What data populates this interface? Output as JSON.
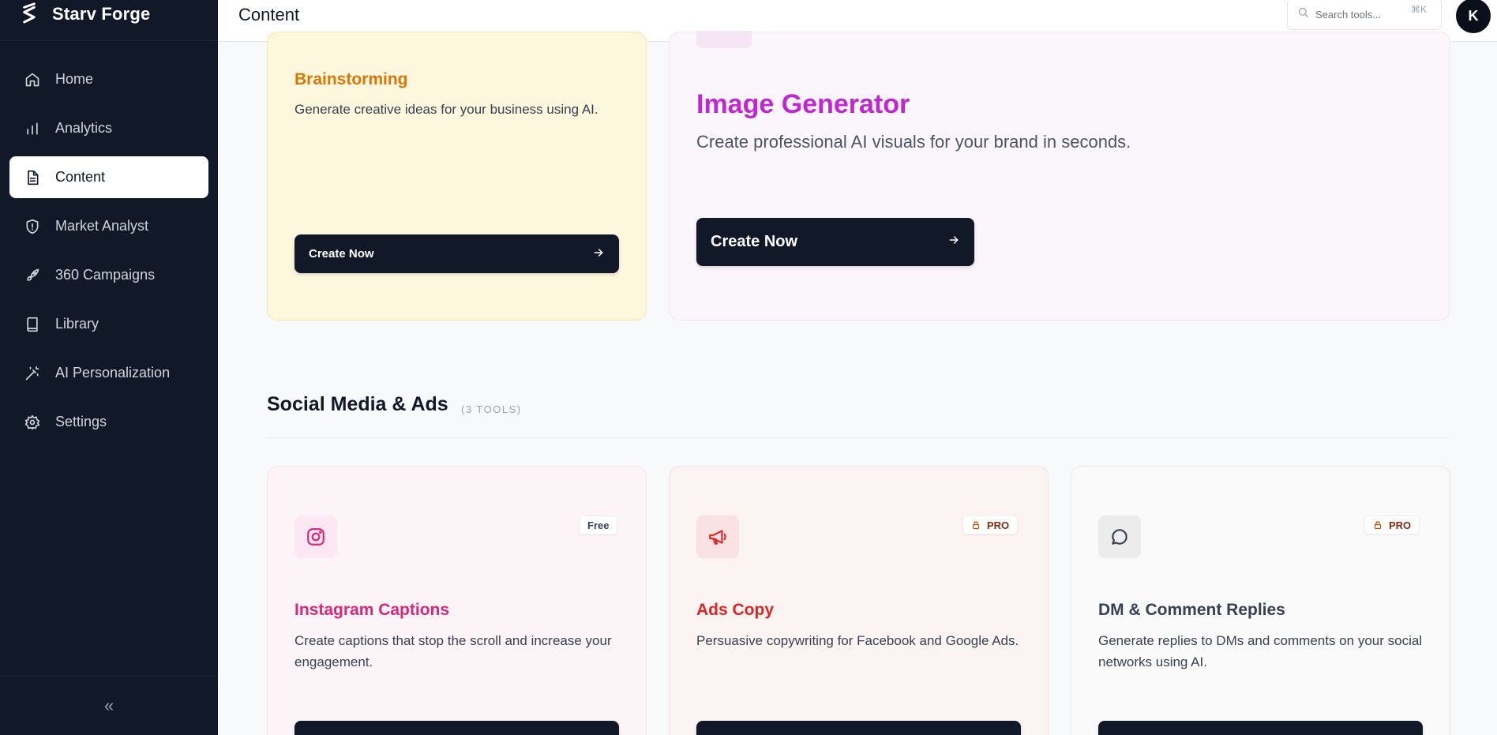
{
  "brand": {
    "name": "Starv Forge"
  },
  "sidebar": {
    "items": [
      {
        "label": "Home",
        "icon": "home-icon",
        "active": false
      },
      {
        "label": "Analytics",
        "icon": "bar-chart-icon",
        "active": false
      },
      {
        "label": "Content",
        "icon": "document-icon",
        "active": true
      },
      {
        "label": "Market Analyst",
        "icon": "shield-icon",
        "active": false
      },
      {
        "label": "360 Campaigns",
        "icon": "rocket-icon",
        "active": false
      },
      {
        "label": "Library",
        "icon": "book-icon",
        "active": false
      },
      {
        "label": "AI Personalization",
        "icon": "magic-wand-icon",
        "active": false
      },
      {
        "label": "Settings",
        "icon": "gear-icon",
        "active": false
      }
    ],
    "collapse_label": "«"
  },
  "header": {
    "title": "Content",
    "search_placeholder": "Search tools...",
    "search_shortcut": "⌘K",
    "avatar_initial": "K"
  },
  "cards": {
    "brainstorming": {
      "title": "Brainstorming",
      "description": "Generate creative ideas for your business using AI.",
      "button": "Create Now"
    },
    "image_generator": {
      "title": "Image Generator",
      "description": "Create professional AI visuals for your brand in seconds.",
      "button": "Create Now"
    }
  },
  "section": {
    "title": "Social Media & Ads",
    "count": "(3 TOOLS)"
  },
  "tools": [
    {
      "title": "Instagram Captions",
      "description": "Create captions that stop the scroll and increase your engagement.",
      "badge": "Free",
      "icon": "instagram-icon"
    },
    {
      "title": "Ads Copy",
      "description": "Persuasive copywriting for Facebook and Google Ads.",
      "badge": "PRO",
      "icon": "megaphone-icon"
    },
    {
      "title": "DM & Comment Replies",
      "description": "Generate replies to DMs and comments on your social networks using AI.",
      "badge": "PRO",
      "icon": "chat-bubble-icon"
    }
  ],
  "colors": {
    "sidebar_bg": "#111827",
    "accent_brainstorm": "#d97706",
    "accent_image": "#c026d3",
    "accent_instagram": "#db2777",
    "accent_ads": "#dc2626"
  }
}
